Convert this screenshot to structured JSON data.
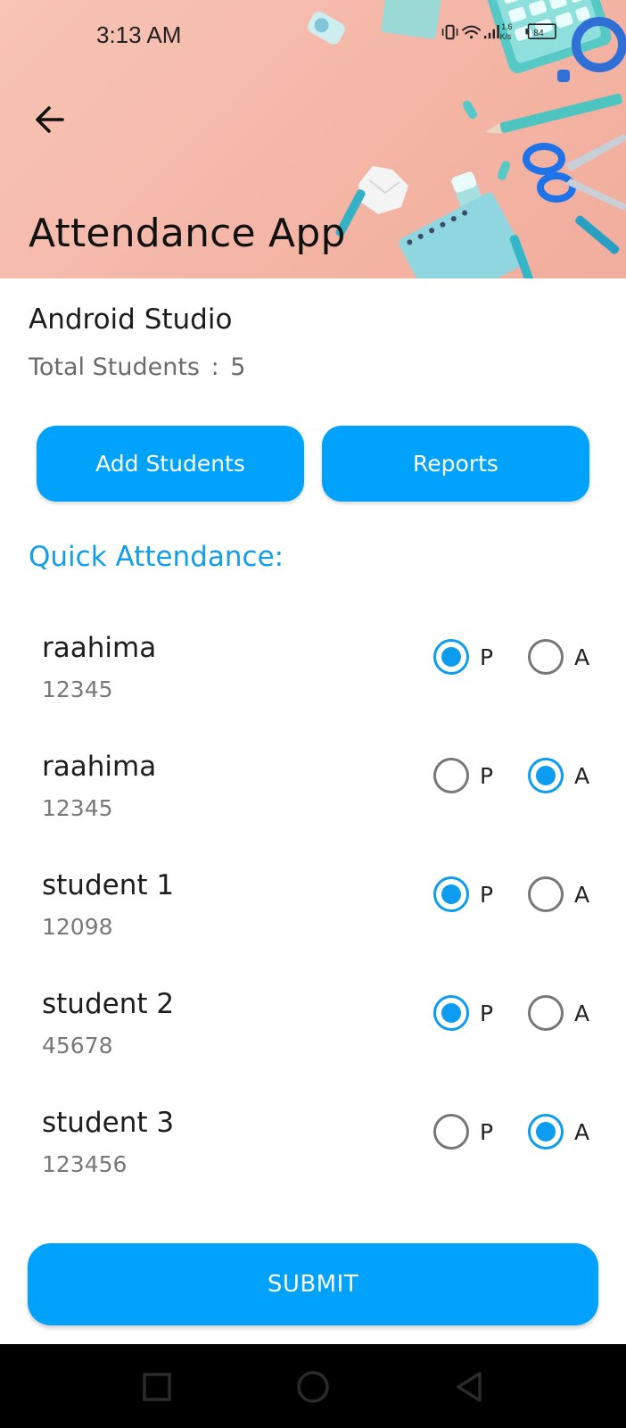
{
  "status_bar": {
    "time": "3:13 AM",
    "network_speed_value": "1.6",
    "network_speed_unit": "K/s",
    "battery": "84",
    "icons": [
      "vibrate-icon",
      "wifi-icon",
      "signal-icon",
      "battery-icon"
    ]
  },
  "header": {
    "back_icon": "arrow-left-icon",
    "title": "Attendance App"
  },
  "course": {
    "name": "Android Studio",
    "total_label": "Total Students",
    "total_separator": ":",
    "total_value": "5"
  },
  "actions": {
    "add_students_label": "Add Students",
    "reports_label": "Reports"
  },
  "quick_attendance": {
    "title": "Quick Attendance:",
    "present_label": "P",
    "absent_label": "A",
    "students": [
      {
        "name": "raahima",
        "id": "12345",
        "status": "P"
      },
      {
        "name": "raahima",
        "id": "12345",
        "status": "A"
      },
      {
        "name": "student 1",
        "id": "12098",
        "status": "P"
      },
      {
        "name": "student 2",
        "id": "45678",
        "status": "P"
      },
      {
        "name": "student 3",
        "id": "123456",
        "status": "A"
      }
    ]
  },
  "submit_label": "SUBMIT",
  "navbar": {
    "icons": [
      "recents-square-icon",
      "home-circle-icon",
      "back-triangle-icon"
    ]
  },
  "colors": {
    "accent": "#00a2fb",
    "accent_text": "#139ee8",
    "banner_bg": "#f4b6a6",
    "navbar_bg": "#000000"
  }
}
